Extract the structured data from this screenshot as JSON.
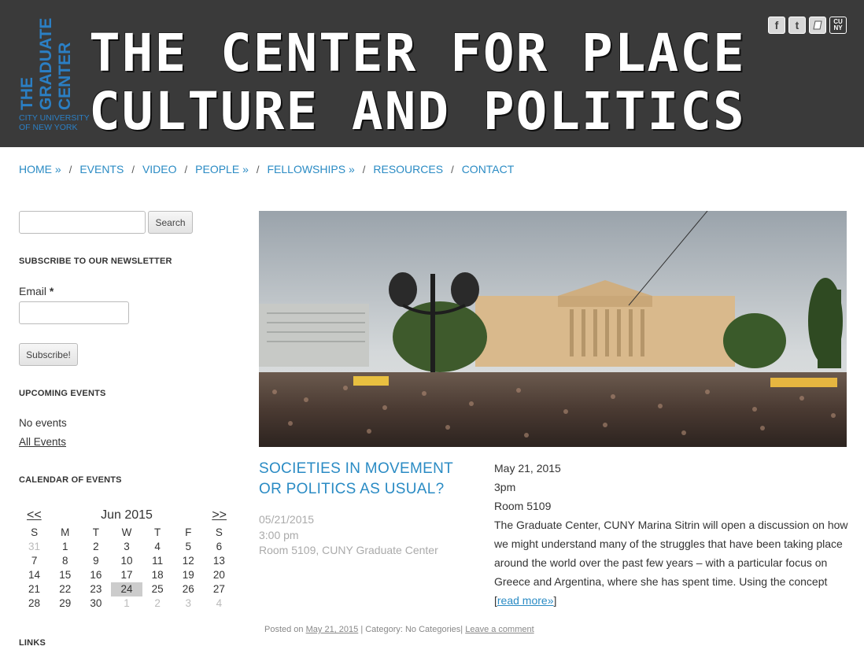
{
  "header": {
    "logo_line1": "THE",
    "logo_line2": "GRADUATE",
    "logo_line3": "CENTER",
    "logo_cuny1": "CITY UNIVERSITY",
    "logo_cuny2": "OF NEW YORK",
    "title_line1": "THE CENTER FOR PLACE",
    "title_line2": "CULTURE AND POLITICS",
    "social": {
      "facebook": "f",
      "twitter": "t",
      "blog": "",
      "cuny_top": "CU",
      "cuny_bottom": "NY"
    }
  },
  "nav": {
    "items": [
      {
        "label": "HOME »"
      },
      {
        "label": "EVENTS"
      },
      {
        "label": "VIDEO"
      },
      {
        "label": "PEOPLE »"
      },
      {
        "label": "FELLOWSHIPS »"
      },
      {
        "label": "RESOURCES"
      },
      {
        "label": "CONTACT"
      }
    ],
    "separator": "/"
  },
  "sidebar": {
    "search_button": "Search",
    "newsletter_title": "SUBSCRIBE TO OUR NEWSLETTER",
    "email_label": "Email",
    "required_mark": "*",
    "subscribe_button": "Subscribe!",
    "upcoming_title": "UPCOMING EVENTS",
    "no_events": "No events",
    "all_events": "All Events",
    "calendar_title": "CALENDAR OF EVENTS",
    "links_title": "LINKS"
  },
  "calendar": {
    "prev": "<<",
    "month": "Jun 2015",
    "next": ">>",
    "weekdays": [
      "S",
      "M",
      "T",
      "W",
      "T",
      "F",
      "S"
    ],
    "weeks": [
      [
        "31",
        "1",
        "2",
        "3",
        "4",
        "5",
        "6"
      ],
      [
        "7",
        "8",
        "9",
        "10",
        "11",
        "12",
        "13"
      ],
      [
        "14",
        "15",
        "16",
        "17",
        "18",
        "19",
        "20"
      ],
      [
        "21",
        "22",
        "23",
        "24",
        "25",
        "26",
        "27"
      ],
      [
        "28",
        "29",
        "30",
        "1",
        "2",
        "3",
        "4"
      ]
    ],
    "today": "24"
  },
  "post": {
    "title": "SOCIETIES IN MOVEMENT OR POLITICS AS USUAL?",
    "date": "05/21/2015",
    "time": "3:00 pm",
    "location": "Room 5109, CUNY Graduate Center",
    "excerpt_date": "May 21, 2015",
    "excerpt_time": "3pm",
    "excerpt_room": "Room 5109",
    "excerpt_body": "The Graduate Center, CUNY Marina Sitrin will open a discussion on how we might understand many of the struggles that have been taking place around the world over the past few years – with a particular focus on Greece and Argentina, where she has spent time. Using the concept",
    "read_more": "read more»",
    "posted_on": "Posted on",
    "posted_date": "May 21, 2015",
    "category": "| Category: No Categories|",
    "comment": "Leave a comment"
  },
  "colors": {
    "header_bg": "#3a3a3a",
    "link_blue": "#2a8bc4",
    "logo_blue": "#2b7fc4"
  }
}
